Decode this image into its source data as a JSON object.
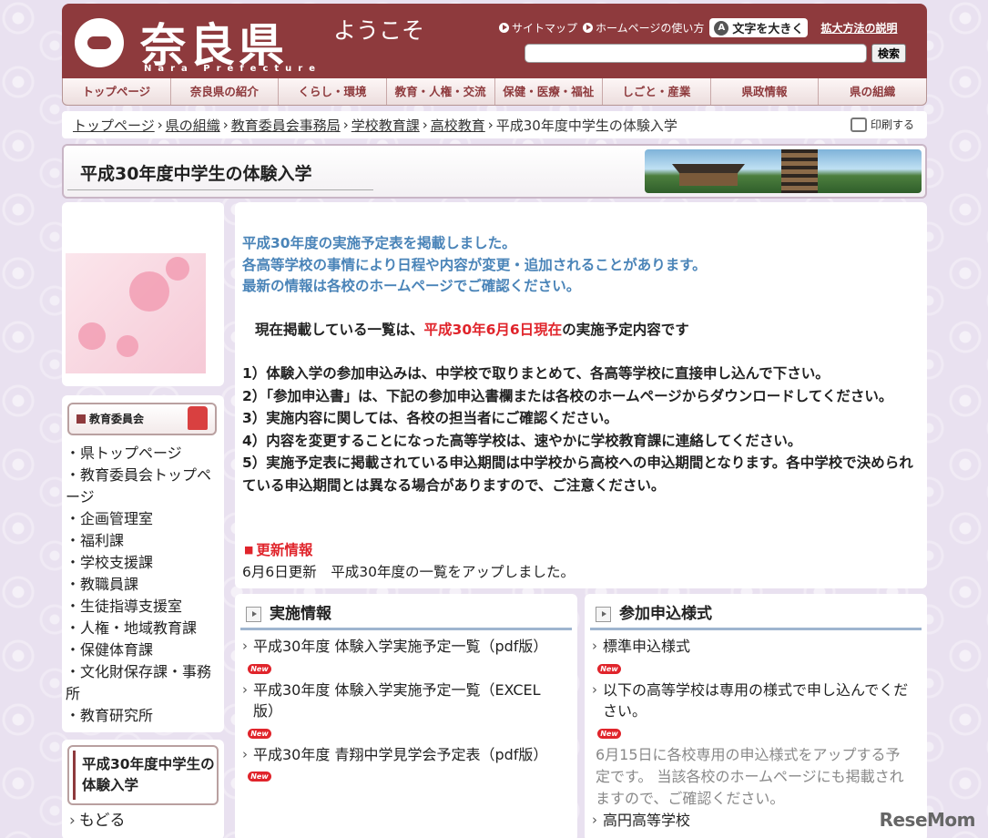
{
  "header": {
    "logo_text": "奈良県",
    "logo_sub": "Nara Prefecture",
    "welcome": "ようこそ",
    "sitemap": "サイトマップ",
    "howto_use": "ホームページの使い方",
    "bigger_text": "文字を大きく",
    "bigger_text_icon_letter": "A",
    "zoom_howto": "拡大方法の説明",
    "search_button": "検索",
    "search_value": ""
  },
  "nav": [
    "トップページ",
    "奈良県の紹介",
    "くらし・環境",
    "教育・人権・交流",
    "保健・医療・福祉",
    "しごと・産業",
    "県政情報",
    "県の組織"
  ],
  "breadcrumb": {
    "items": [
      "トップページ",
      "県の組織",
      "教育委員会事務局",
      "学校教育課",
      "高校教育"
    ],
    "current": "平成30年度中学生の体験入学",
    "print": "印刷する"
  },
  "page_title": "平成30年度中学生の体験入学",
  "sidebar": {
    "heading": "教育委員会",
    "links": [
      "・県トップページ",
      "・教育委員会トップページ",
      "・企画管理室",
      "・福利課",
      "・学校支援課",
      "・教職員課",
      "・生徒指導支援室",
      "・人権・地域教育課",
      "・保健体育課",
      "・文化財保存課・事務所",
      "・教育研究所"
    ],
    "current_page": "平成30年度中学生の体験入学",
    "back": "もどる"
  },
  "main": {
    "notice": [
      "平成30年度の実施予定表を掲載しました。",
      "各高等学校の事情により日程や内容が変更・追加されることがあります。",
      "最新の情報は各校のホームページでご確認ください。"
    ],
    "current_pre": "現在掲載している一覧は、",
    "current_date": "平成30年6月6日現在",
    "current_post": "の実施予定内容です",
    "rules": [
      "1）体験入学の参加申込みは、中学校で取りまとめて、各高等学校に直接申し込んで下さい。",
      "2）「参加申込書」は、下記の参加申込書欄または各校のホームページからダウンロードしてください。",
      "3）実施内容に関しては、各校の担当者にご確認ください。",
      "4）内容を変更することになった高等学校は、速やかに学校教育課に連絡してください。",
      "5）実施予定表に掲載されている申込期間は中学校から高校への申込期間となります。各中学校で決められている申込期間とは異なる場合がありますので、ご注意ください。"
    ],
    "update_heading": "更新情報",
    "update_text": "6月6日更新　平成30年度の一覧をアップしました。"
  },
  "panel_left": {
    "title": "実施情報",
    "items": [
      "平成30年度 体験入学実施予定一覧（pdf版）",
      "平成30年度 体験入学実施予定一覧（EXCEL版）",
      "平成30年度 青翔中学見学会予定表（pdf版）"
    ],
    "new_label": "New"
  },
  "panel_right": {
    "title": "参加申込様式",
    "items": [
      "標準申込様式",
      "以下の高等学校は専用の様式で申し込んでください。"
    ],
    "note": "6月15日に各校専用の申込様式をアップする予定です。 当該各校のホームページにも掲載されますので、ご確認ください。",
    "last_item": "高円高等学校",
    "new_label": "New"
  },
  "watermark": "ReseMom"
}
